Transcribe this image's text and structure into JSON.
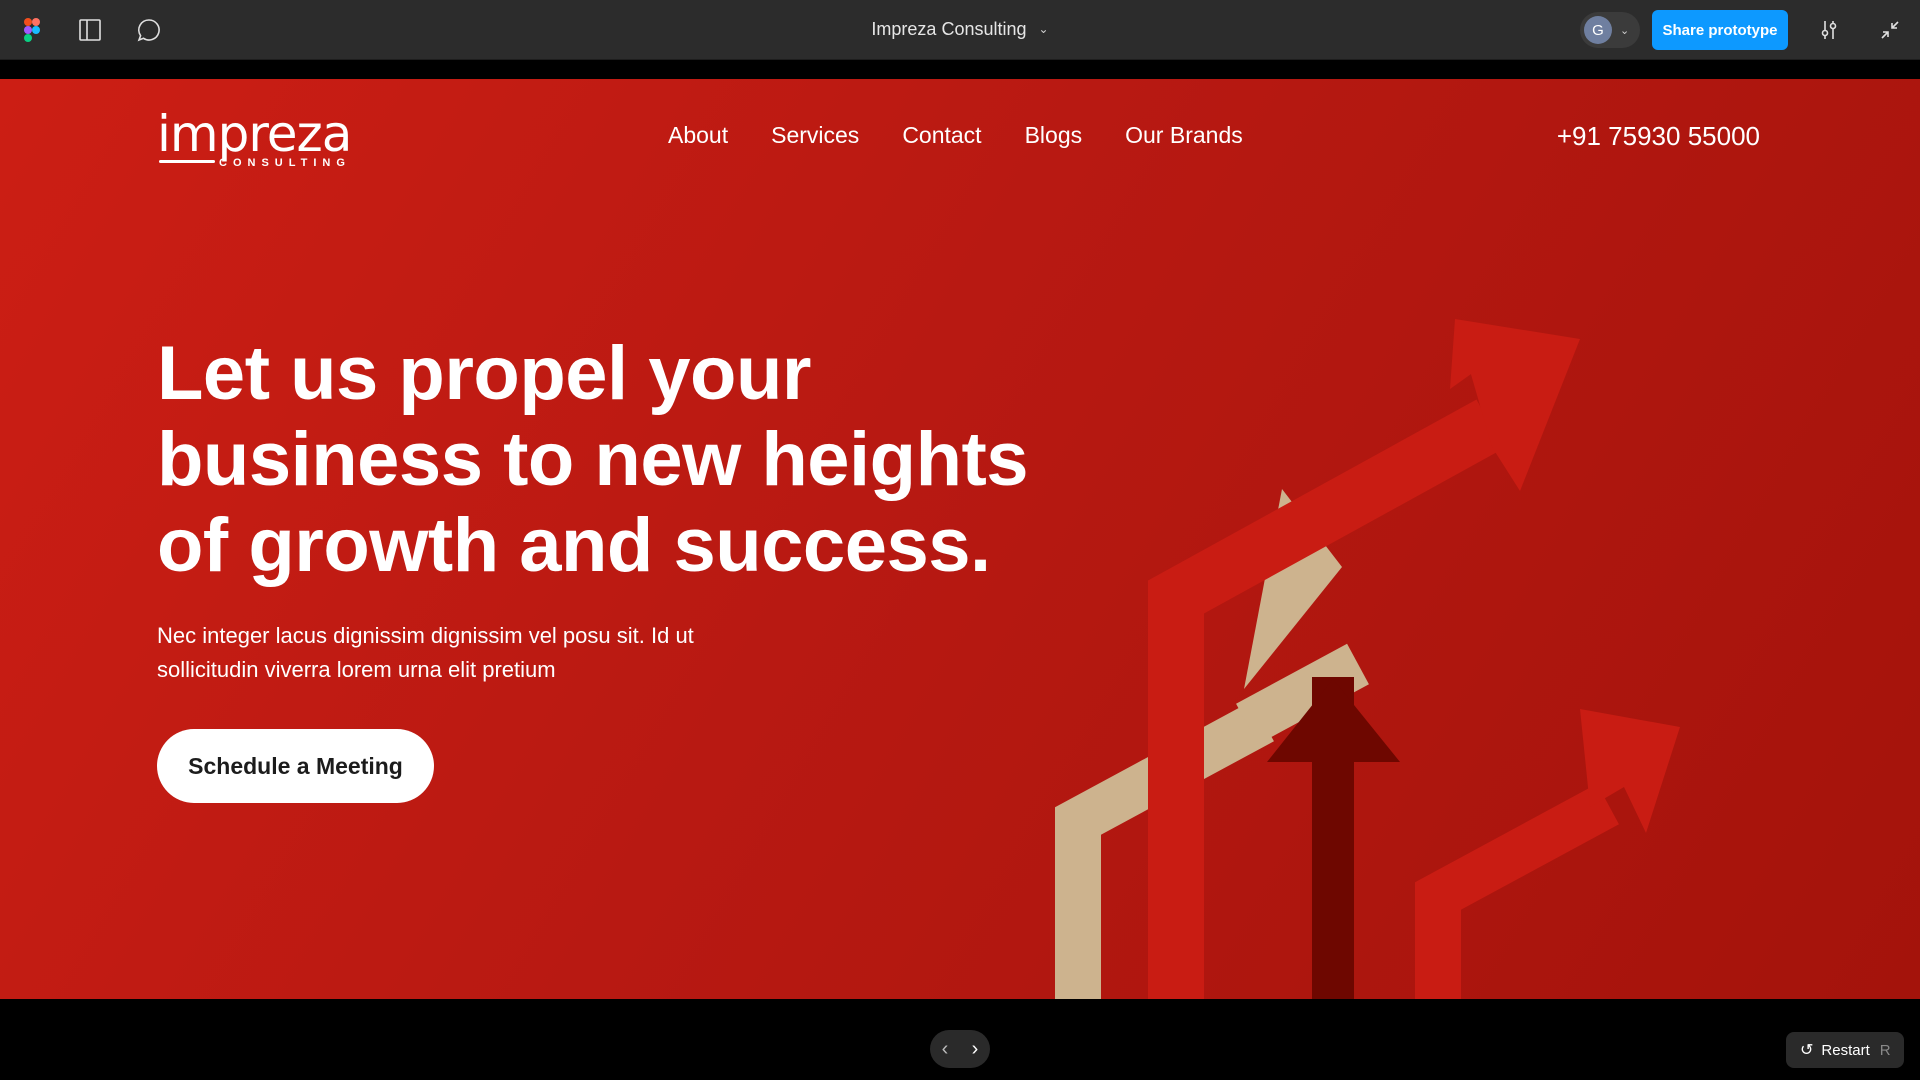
{
  "toolbar": {
    "file_title": "Impreza Consulting",
    "avatar_initial": "G",
    "share_label": "Share prototype",
    "icons": [
      "figma-logo-icon",
      "panel-toggle-icon",
      "comment-icon",
      "settings-sliders-icon",
      "collapse-icon"
    ],
    "accent_color": "#0d99ff"
  },
  "site": {
    "logo": {
      "word": "impreza",
      "sub": "CONSULTING"
    },
    "nav": [
      {
        "label": "About"
      },
      {
        "label": "Services"
      },
      {
        "label": "Contact"
      },
      {
        "label": "Blogs"
      },
      {
        "label": "Our Brands"
      }
    ],
    "phone": "+91 75930 55000",
    "hero": {
      "title_lines": [
        "Let us propel your",
        "business to new heights",
        "of growth and success."
      ],
      "subtitle": "Nec integer lacus dignissim dignissim vel posu sit. Id ut sollicitudin viverra lorem urna elit pretium",
      "cta": "Schedule a Meeting"
    },
    "colors": {
      "brand_red": "#c41a12",
      "beige": "#cdb38e",
      "dark_red": "#6e0700"
    }
  },
  "controls": {
    "prev_icon": "chevron-left-icon",
    "next_icon": "chevron-right-icon",
    "restart_label": "Restart",
    "restart_key": "R"
  }
}
